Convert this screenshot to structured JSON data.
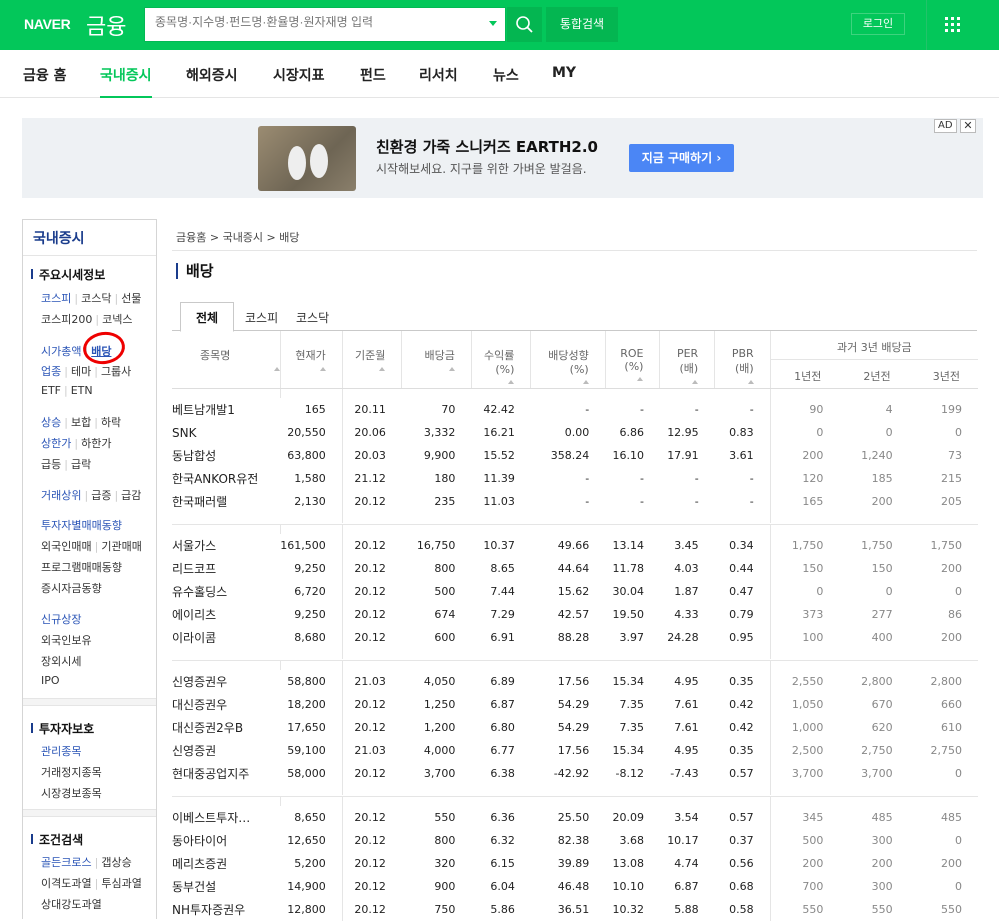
{
  "header": {
    "logo": "NAVER",
    "service": "금융",
    "search_placeholder": "종목명·지수명·펀드명·환율명·원자재명 입력",
    "total_search": "통합검색",
    "login": "로그인"
  },
  "nav": [
    "금융 홈",
    "국내증시",
    "해외증시",
    "시장지표",
    "펀드",
    "리서치",
    "뉴스",
    "MY"
  ],
  "ad": {
    "title": "친환경 가죽 스니커즈 EARTH2.0",
    "subtitle": "시작해보세요. 지구를 위한 가벼운 발걸음.",
    "cta": "지금 구매하기 ›",
    "badge": "AD",
    "close": "✕"
  },
  "sidebar": {
    "title": "국내증시",
    "sections": [
      {
        "title": "주요시세정보"
      },
      {
        "title": "투자자보호"
      },
      {
        "title": "조건검색"
      }
    ],
    "rows": [
      [
        "코스피",
        "코스닥",
        "선물"
      ],
      [
        "코스피200",
        "코넥스"
      ],
      [
        "시가총액",
        "배당"
      ],
      [
        "업종",
        "테마",
        "그룹사"
      ],
      [
        "ETF",
        "ETN"
      ],
      [
        "상승",
        "보합",
        "하락"
      ],
      [
        "상한가",
        "하한가"
      ],
      [
        "급등",
        "급락"
      ],
      [
        "거래상위",
        "급증",
        "급감"
      ],
      [
        "투자자별매매동향"
      ],
      [
        "외국인매매",
        "기관매매"
      ],
      [
        "프로그램매매동향"
      ],
      [
        "증시자금동향"
      ],
      [
        "신규상장"
      ],
      [
        "외국인보유"
      ],
      [
        "장외시세"
      ],
      [
        "IPO"
      ],
      [
        "관리종목"
      ],
      [
        "거래정지종목"
      ],
      [
        "시장경보종목"
      ],
      [
        "골든크로스",
        "갭상승"
      ],
      [
        "이격도과열",
        "투심과열"
      ],
      [
        "상대강도과열"
      ]
    ]
  },
  "breadcrumb": "금융홈 > 국내증시 > 배당",
  "page_title": "배당",
  "tabs": [
    "전체",
    "코스피",
    "코스닥"
  ],
  "table": {
    "headers": [
      "종목명",
      "현재가",
      "기준월",
      "배당금",
      "수익률\n(%)",
      "배당성향\n(%)",
      "ROE\n(%)",
      "PER\n(배)",
      "PBR\n(배)"
    ],
    "group_header": "과거 3년 배당금",
    "sub_headers": [
      "1년전",
      "2년전",
      "3년전"
    ],
    "groups": [
      [
        [
          "베트남개발1",
          "165",
          "20.11",
          "70",
          "42.42",
          "-",
          "-",
          "-",
          "-",
          "90",
          "4",
          "199"
        ],
        [
          "SNK",
          "20,550",
          "20.06",
          "3,332",
          "16.21",
          "0.00",
          "6.86",
          "12.95",
          "0.83",
          "0",
          "0",
          "0"
        ],
        [
          "동남합성",
          "63,800",
          "20.03",
          "9,900",
          "15.52",
          "358.24",
          "16.10",
          "17.91",
          "3.61",
          "200",
          "1,240",
          "73"
        ],
        [
          "한국ANKOR유전",
          "1,580",
          "21.12",
          "180",
          "11.39",
          "-",
          "-",
          "-",
          "-",
          "120",
          "185",
          "215"
        ],
        [
          "한국패러랠",
          "2,130",
          "20.12",
          "235",
          "11.03",
          "-",
          "-",
          "-",
          "-",
          "165",
          "200",
          "205"
        ]
      ],
      [
        [
          "서울가스",
          "161,500",
          "20.12",
          "16,750",
          "10.37",
          "49.66",
          "13.14",
          "3.45",
          "0.34",
          "1,750",
          "1,750",
          "1,750"
        ],
        [
          "리드코프",
          "9,250",
          "20.12",
          "800",
          "8.65",
          "44.64",
          "11.78",
          "4.03",
          "0.44",
          "150",
          "150",
          "200"
        ],
        [
          "유수홀딩스",
          "6,720",
          "20.12",
          "500",
          "7.44",
          "15.62",
          "30.04",
          "1.87",
          "0.47",
          "0",
          "0",
          "0"
        ],
        [
          "에이리츠",
          "9,250",
          "20.12",
          "674",
          "7.29",
          "42.57",
          "19.50",
          "4.33",
          "0.79",
          "373",
          "277",
          "86"
        ],
        [
          "이라이콤",
          "8,680",
          "20.12",
          "600",
          "6.91",
          "88.28",
          "3.97",
          "24.28",
          "0.95",
          "100",
          "400",
          "200"
        ]
      ],
      [
        [
          "신영증권우",
          "58,800",
          "21.03",
          "4,050",
          "6.89",
          "17.56",
          "15.34",
          "4.95",
          "0.35",
          "2,550",
          "2,800",
          "2,800"
        ],
        [
          "대신증권우",
          "18,200",
          "20.12",
          "1,250",
          "6.87",
          "54.29",
          "7.35",
          "7.61",
          "0.42",
          "1,050",
          "670",
          "660"
        ],
        [
          "대신증권2우B",
          "17,650",
          "20.12",
          "1,200",
          "6.80",
          "54.29",
          "7.35",
          "7.61",
          "0.42",
          "1,000",
          "620",
          "610"
        ],
        [
          "신영증권",
          "59,100",
          "21.03",
          "4,000",
          "6.77",
          "17.56",
          "15.34",
          "4.95",
          "0.35",
          "2,500",
          "2,750",
          "2,750"
        ],
        [
          "현대중공업지주",
          "58,000",
          "20.12",
          "3,700",
          "6.38",
          "-42.92",
          "-8.12",
          "-7.43",
          "0.57",
          "3,700",
          "3,700",
          "0"
        ]
      ],
      [
        [
          "이베스트투자…",
          "8,650",
          "20.12",
          "550",
          "6.36",
          "25.50",
          "20.09",
          "3.54",
          "0.57",
          "345",
          "485",
          "485"
        ],
        [
          "동아타이어",
          "12,650",
          "20.12",
          "800",
          "6.32",
          "82.38",
          "3.68",
          "10.17",
          "0.37",
          "500",
          "300",
          "0"
        ],
        [
          "메리츠증권",
          "5,200",
          "20.12",
          "320",
          "6.15",
          "39.89",
          "13.08",
          "4.74",
          "0.56",
          "200",
          "200",
          "200"
        ],
        [
          "동부건설",
          "14,900",
          "20.12",
          "900",
          "6.04",
          "46.48",
          "10.10",
          "6.87",
          "0.68",
          "700",
          "300",
          "0"
        ],
        [
          "NH투자증권우",
          "12,800",
          "20.12",
          "750",
          "5.86",
          "36.51",
          "10.32",
          "5.88",
          "0.58",
          "550",
          "550",
          "550"
        ]
      ]
    ]
  }
}
